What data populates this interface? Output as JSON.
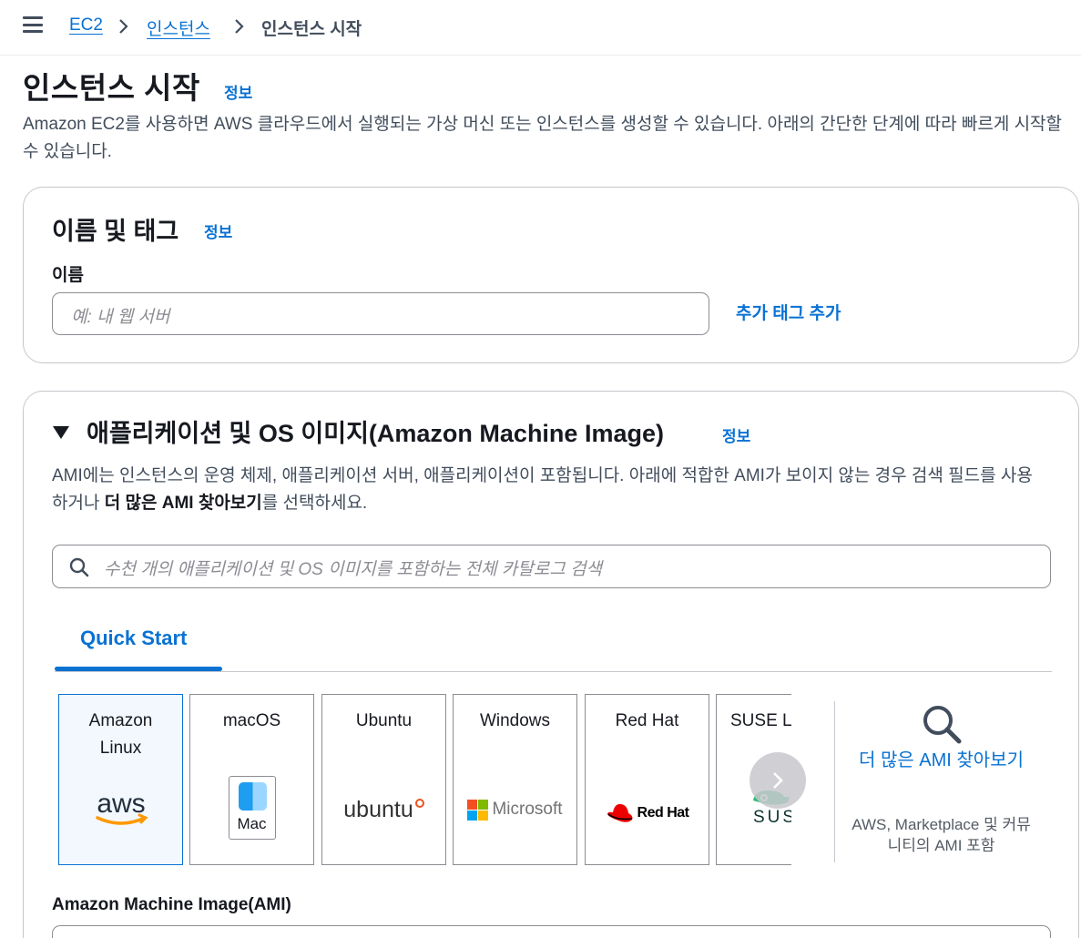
{
  "breadcrumb": {
    "items": [
      "EC2",
      "인스턴스",
      "인스턴스 시작"
    ]
  },
  "page": {
    "title": "인스턴스 시작",
    "info": "정보",
    "description": "Amazon EC2를 사용하면 AWS 클라우드에서 실행되는 가상 머신 또는 인스턴스를 생성할 수 있습니다. 아래의 간단한 단계에 따라 빠르게 시작할 수 있습니다."
  },
  "name_tags": {
    "title": "이름 및 태그",
    "info": "정보",
    "name_label": "이름",
    "name_placeholder": "예: 내 웹 서버",
    "add_tags": "추가 태그 추가"
  },
  "ami": {
    "title": "애플리케이션 및 OS 이미지(Amazon Machine Image)",
    "info": "정보",
    "desc_part1": "AMI에는 인스턴스의 운영 체제, 애플리케이션 서버, 애플리케이션이 포함됩니다. 아래에 적합한 AMI가 보이지 않는 경우 검색 필드를 사용하거나 ",
    "desc_bold": "더 많은 AMI 찾아보기",
    "desc_part2": "를 선택하세요.",
    "search_placeholder": "수천 개의 애플리케이션 및 OS 이미지를 포함하는 전체 카탈로그 검색",
    "tab": "Quick Start",
    "tiles": [
      {
        "label": "Amazon Linux",
        "logo": "aws-logo",
        "selected": true
      },
      {
        "label": "macOS",
        "logo": "mac-logo",
        "logo_text": "Mac"
      },
      {
        "label": "Ubuntu",
        "logo": "ubuntu-logo",
        "logo_text": "ubuntu"
      },
      {
        "label": "Windows",
        "logo": "microsoft-logo",
        "logo_text": "Microsoft"
      },
      {
        "label": "Red Hat",
        "logo": "redhat-logo",
        "logo_text": "Red Hat"
      },
      {
        "label": "SUSE L",
        "logo": "suse-logo",
        "logo_text": "SUS"
      }
    ],
    "browse_more": "더 많은 AMI 찾아보기",
    "browse_sub": "AWS, Marketplace 및 커뮤니티의 AMI 포함",
    "ami_label": "Amazon Machine Image(AMI)"
  },
  "colors": {
    "link": "#0972d3",
    "text": "#16191f",
    "border": "#8c8c94"
  }
}
